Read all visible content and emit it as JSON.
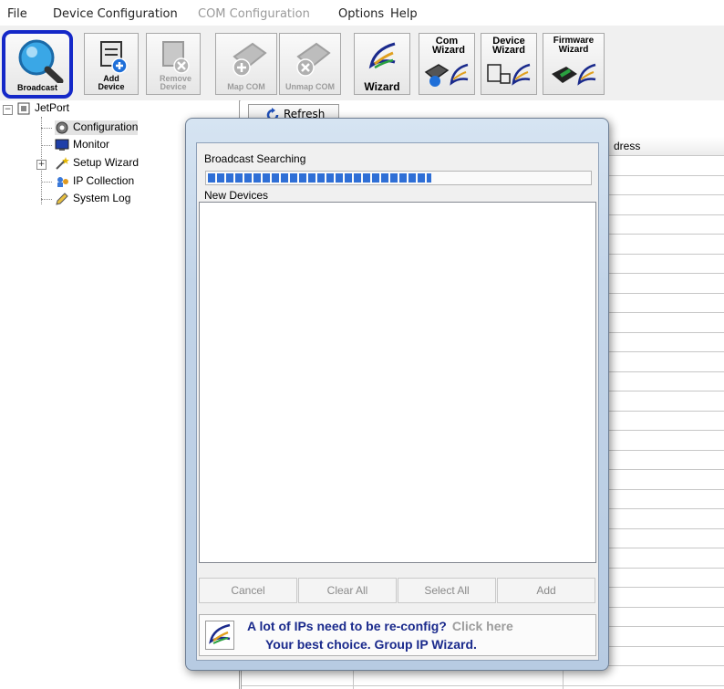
{
  "menu": {
    "items": [
      {
        "label": "File",
        "enabled": true
      },
      {
        "label": "Device Configuration",
        "enabled": true
      },
      {
        "label": "COM Configuration",
        "enabled": false
      },
      {
        "label": "Options",
        "enabled": true
      },
      {
        "label": "Help",
        "enabled": true
      }
    ]
  },
  "toolbar": {
    "broadcast_label": "Broadcast",
    "add_device_label": "Add Device",
    "remove_device_label": "Remove Device",
    "map_com_label": "Map COM",
    "unmap_com_label": "Unmap COM",
    "wizard_label": "Wizard",
    "com_wizard_label": "Com Wizard",
    "device_wizard_label": "Device Wizard",
    "firmware_wizard_label": "Firmware Wizard"
  },
  "tree": {
    "root": "JetPort",
    "items": [
      "Configuration",
      "Monitor",
      "Setup Wizard",
      "IP Collection",
      "System Log"
    ]
  },
  "main": {
    "refresh_label": "Refresh",
    "visible_header": "dress"
  },
  "dialog": {
    "progress_label": "Broadcast Searching",
    "progress_fraction": 0.58,
    "list_label": "New Devices",
    "buttons": [
      "Cancel",
      "Clear All",
      "Select All",
      "Add"
    ],
    "banner_line1": "A lot of IPs need to be re-config?",
    "banner_hint": "Click here",
    "banner_line2": "Your best choice. Group IP Wizard."
  },
  "colors": {
    "selection_outline": "#1428c8",
    "progress_fill": "#2f6fd6",
    "banner_text": "#1a2a8c"
  }
}
